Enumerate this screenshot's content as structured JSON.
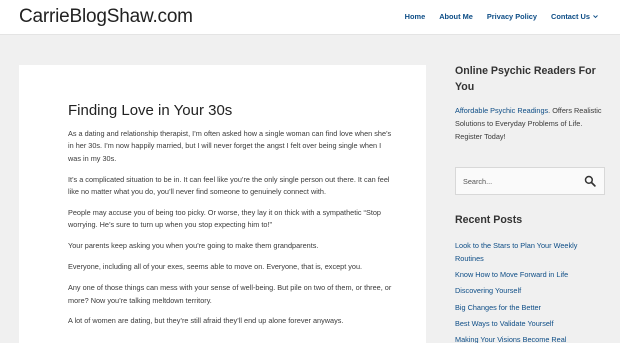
{
  "site": {
    "logo": "CarrieBlogShaw.com"
  },
  "nav": {
    "items": [
      {
        "label": "Home"
      },
      {
        "label": "About Me"
      },
      {
        "label": "Privacy Policy"
      },
      {
        "label": "Contact Us"
      }
    ]
  },
  "article": {
    "title": "Finding Love in Your 30s",
    "paragraphs": [
      "As a dating and relationship therapist, I’m often asked how a single woman can find love when she’s in her 30s. I’m now happily married, but I will never forget the angst I felt over being single when I was in my 30s.",
      "It’s a complicated situation to be in. It can feel like you’re the only single person out there. It can feel like no matter what you do, you’ll never find someone to genuinely connect with.",
      "People may accuse you of being too picky. Or worse, they lay it on thick with a sympathetic “Stop worrying. He’s sure to turn up when you stop expecting him to!”",
      "Your parents keep asking you when you’re going to make them grandparents.",
      "Everyone, including all of your exes, seems able to move on. Everyone, that is, except you.",
      "Any one of those things can mess with your sense of well-being. But pile on two of them, or three, or more? Now you’re talking meltdown territory.",
      "A lot of women are dating, but they’re still afraid they’ll end up alone forever anyways."
    ]
  },
  "sidebar": {
    "psychic": {
      "title": "Online Psychic Readers For You",
      "link": "Affordable Psychic Readings",
      "text": ". Offers Realistic Solutions to Everyday Problems of Life. Register Today!"
    },
    "search": {
      "placeholder": "Search..."
    },
    "recent": {
      "title": "Recent Posts",
      "items": [
        "Look to the Stars to Plan Your Weekly Routines",
        "Know How to Move Forward in Life",
        "Discovering Yourself",
        "Big Changes for the Better",
        "Best Ways to Validate Yourself",
        "Making Your Visions Become Real"
      ]
    }
  },
  "colors": {
    "link": "#0d4d86",
    "background": "#f0f0f0"
  },
  "icons": {
    "search": "search-icon",
    "caret": "chevron-down-icon"
  }
}
